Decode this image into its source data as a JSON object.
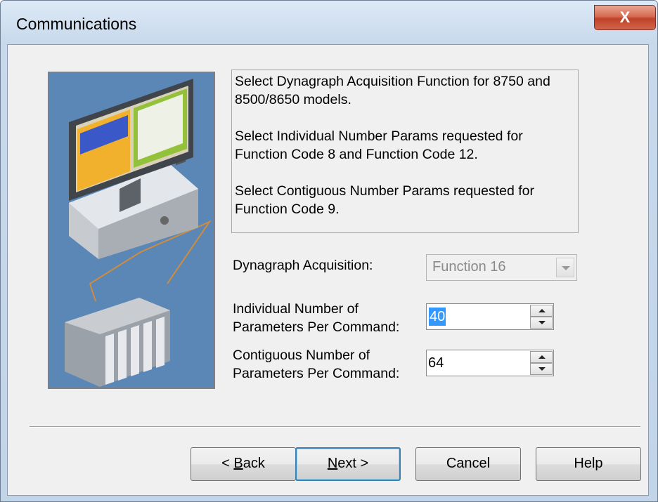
{
  "window": {
    "title": "Communications",
    "close_glyph": "X"
  },
  "info": {
    "paragraphs": [
      "Select Dynagraph Acquisition Function for 8750 and 8500/8650 models.",
      "Select Individual Number Params requested for Function Code 8 and Function Code 12.",
      "Select Contiguous Number Params requested for Function Code 9."
    ]
  },
  "fields": {
    "dynagraph": {
      "label": "Dynagraph Acquisition:",
      "value": "Function 16"
    },
    "individual": {
      "label_line1": "Individual Number of",
      "label_line2": "Parameters Per Command:",
      "value": "40"
    },
    "contiguous": {
      "label_line1": "Contiguous Number of",
      "label_line2": "Parameters Per Command:",
      "value": "64"
    }
  },
  "buttons": {
    "back": {
      "prefix": "< ",
      "key": "B",
      "rest": "ack"
    },
    "next": {
      "key": "N",
      "rest": "ext >"
    },
    "cancel": "Cancel",
    "help": "Help"
  },
  "colors": {
    "accent": "#3399ff",
    "close": "#c0422a",
    "image_bg": "#5b87b6"
  },
  "icons": [
    "close-icon",
    "computer-plc-illustration",
    "dropdown-arrow-icon",
    "spin-up-icon",
    "spin-down-icon"
  ]
}
